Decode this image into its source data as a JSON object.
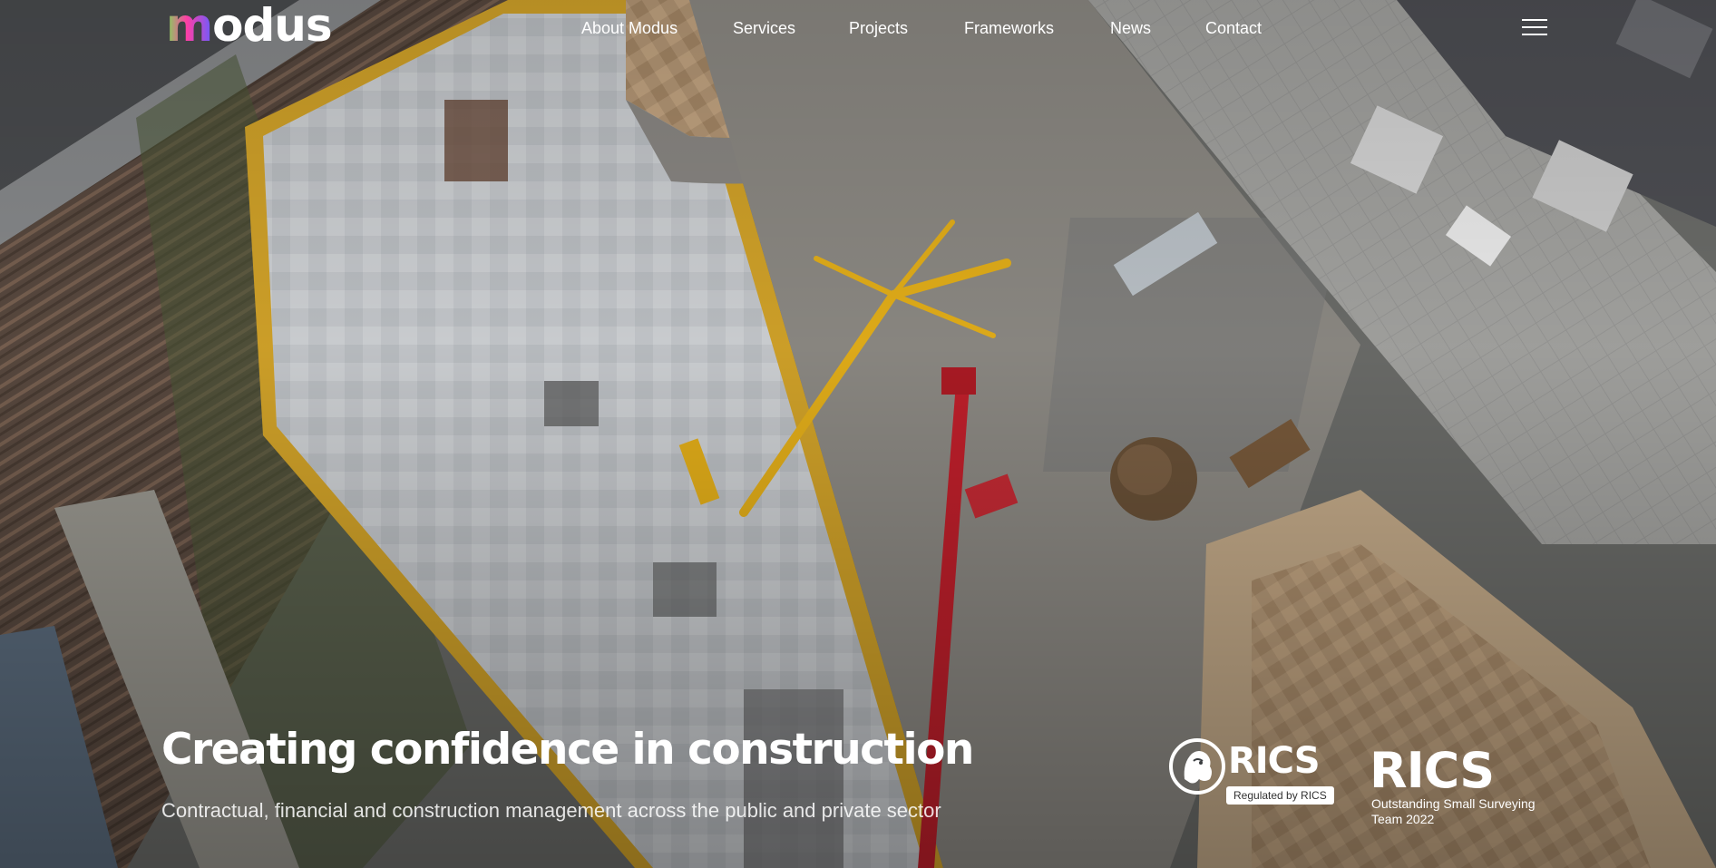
{
  "brand": {
    "logo_first": "m",
    "logo_rest": "odus",
    "logo_gradient": [
      "#7ed957",
      "#ff3ea5",
      "#6a5cff"
    ]
  },
  "nav": {
    "items": [
      {
        "label": "About Modus"
      },
      {
        "label": "Services"
      },
      {
        "label": "Projects"
      },
      {
        "label": "Frameworks"
      },
      {
        "label": "News"
      },
      {
        "label": "Contact"
      }
    ],
    "menu_icon": "hamburger-menu-icon"
  },
  "hero": {
    "title": "Creating confidence in construction",
    "subtitle": "Contractual, financial and construction management across the public and private sector",
    "background": "aerial-construction-site-photo"
  },
  "badges": {
    "regulated": {
      "mark": "RICS",
      "caption": "Regulated by RICS",
      "icon": "rics-lion-icon"
    },
    "award": {
      "mark": "RICS",
      "line1": "Outstanding Small Surveying",
      "line2": "Team 2022"
    }
  },
  "colors": {
    "text": "#ffffff",
    "crane_yellow": "#e8b21a",
    "crane_red": "#c4202c"
  }
}
